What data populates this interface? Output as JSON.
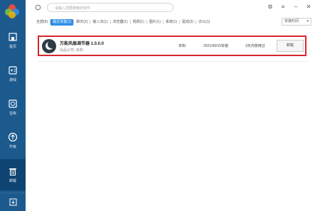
{
  "sidebar": {
    "items": [
      {
        "label": "首页",
        "icon": "home-icon"
      },
      {
        "label": "游戏",
        "icon": "gamepad-icon"
      },
      {
        "label": "宝库",
        "icon": "vault-icon"
      },
      {
        "label": "升级",
        "icon": "upgrade-icon"
      },
      {
        "label": "卸载",
        "icon": "trash-icon"
      }
    ],
    "active": "卸载"
  },
  "topbar": {
    "search_placeholder": "请输入您要搜索的软件"
  },
  "tabs": [
    {
      "label": "全部(8)"
    },
    {
      "label": "最近安装(1)",
      "active": true
    },
    {
      "label": "聊天(2)"
    },
    {
      "label": "输入法(1)"
    },
    {
      "label": "浏览器(1)"
    },
    {
      "label": "视频(1)"
    },
    {
      "label": "图片(1)"
    },
    {
      "label": "系统(1)"
    },
    {
      "label": "驱动(3)"
    },
    {
      "label": "办公(1)"
    }
  ],
  "sort": {
    "label": "安装时间"
  },
  "app": {
    "name": "万能风扇调节器 1.0.0.0",
    "publisher": "出品公司: 未知",
    "size": "未知",
    "date": "2021/09/15安装",
    "usage": "3天内使用过",
    "uninstall_label": "卸载"
  },
  "colors": {
    "sidebar": "#1c5a8e",
    "accent": "#2f8ee8",
    "highlight": "#d9252b"
  }
}
